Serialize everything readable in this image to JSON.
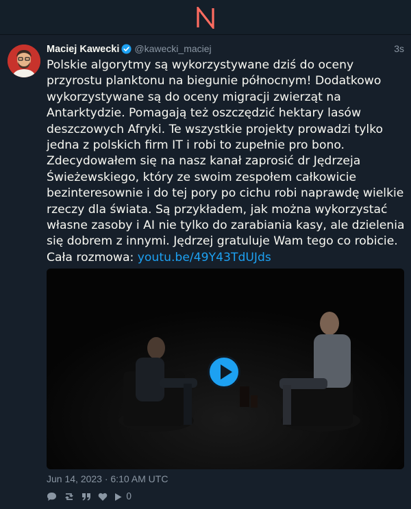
{
  "app": {
    "logo_icon": "nitter-logo-icon",
    "accent": "#ff6c60"
  },
  "tweet": {
    "fullname": "Maciej Kawecki",
    "username": "@kawecki_maciej",
    "time_ago": "3s",
    "verified_icon": "verified-badge-icon",
    "text": "Polskie algorytmy są wykorzystywane dziś do oceny przyrostu planktonu na biegunie północnym! Dodatkowo wykorzystywane są do oceny migracji zwierząt na Antarktydzie. Pomagają też oszczędzić hektary lasów deszczowych Afryki. Te wszystkie projekty prowadzi tylko jedna z polskich firm IT i robi to zupełnie pro bono. Zdecydowałem się na nasz kanał zaprosić dr Jędrzeja Świeżewskiego, który ze swoim zespołem całkowicie bezinteresownie i do tej pory po cichu robi naprawdę wielkie rzeczy dla świata. Są przykładem, jak można wykorzystać własne zasoby i AI nie tylko do zarabiania kasy, ale dzielenia się dobrem z innymi. Jędrzej gratuluje Wam tego co robicie. Cała rozmowa: ",
    "link": "youtu.be/49Y43TdUJds",
    "date": "Jun 14, 2023 · 6:10 AM UTC",
    "stats": {
      "comments_icon": "comment-icon",
      "retweets_icon": "retweet-icon",
      "quotes_icon": "quote-icon",
      "likes_icon": "heart-icon",
      "views_icon": "play-icon",
      "views": "0"
    }
  }
}
